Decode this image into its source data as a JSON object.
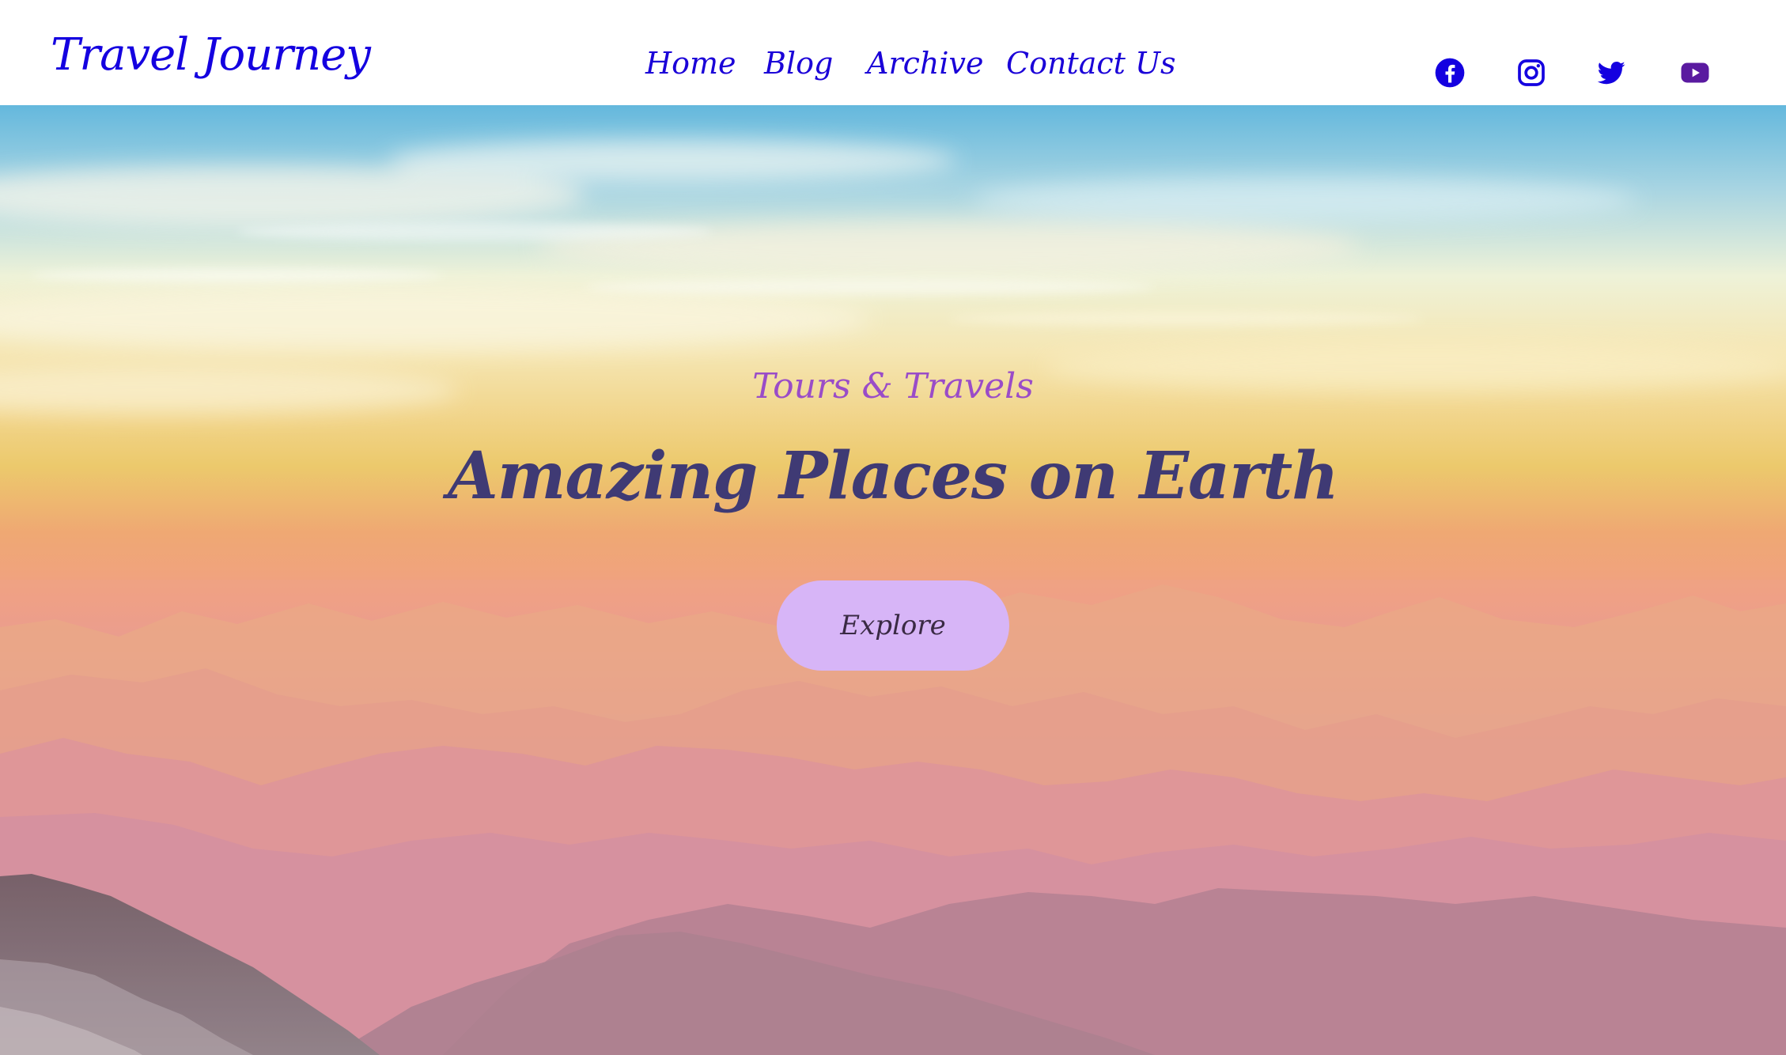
{
  "header": {
    "logo": "Travel Journey",
    "nav": [
      {
        "label": "Home"
      },
      {
        "label": "Blog"
      },
      {
        "label": "Archive"
      },
      {
        "label": "Contact Us"
      }
    ],
    "social": [
      {
        "icon": "facebook-icon",
        "color": "#1400e0"
      },
      {
        "icon": "instagram-icon",
        "color": "#1400e0"
      },
      {
        "icon": "twitter-icon",
        "color": "#1400e0"
      },
      {
        "icon": "youtube-icon",
        "color": "#5a1aa0"
      }
    ]
  },
  "hero": {
    "subtitle": "Tours & Travels",
    "title": "Amazing Places on Earth",
    "button_label": "Explore",
    "colors": {
      "subtitle": "#9a4cc8",
      "title": "#3f3a74",
      "button_bg": "#d7b5f7"
    }
  }
}
